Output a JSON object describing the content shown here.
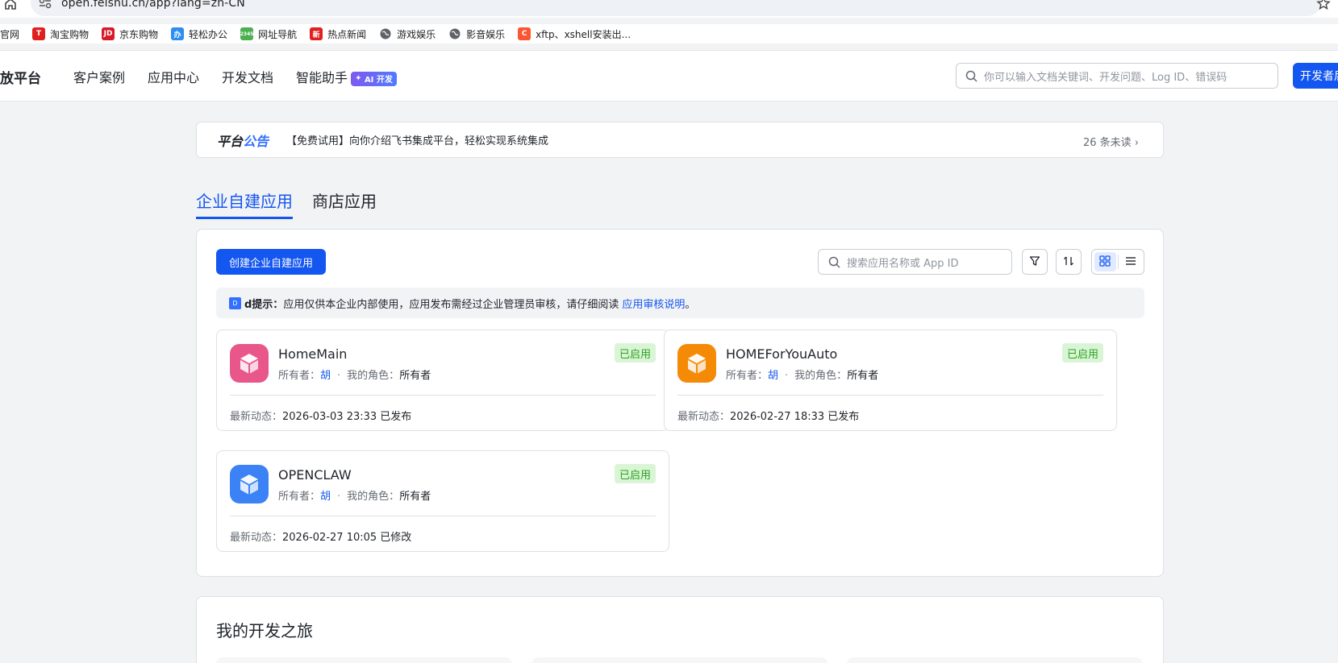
{
  "browser": {
    "url": "open.feishu.cn/app?lang=zh-CN",
    "bookmarks": [
      {
        "label": "官网",
        "icon": "",
        "color": ""
      },
      {
        "label": "淘宝购物",
        "icon": "T",
        "color": "#e0201c"
      },
      {
        "label": "京东购物",
        "icon": "JD",
        "color": "#d8192a"
      },
      {
        "label": "轻松办公",
        "icon": "办",
        "color": "#2b8ef0"
      },
      {
        "label": "网址导航",
        "icon": "2345",
        "color": "#4caf50"
      },
      {
        "label": "热点新闻",
        "icon": "新",
        "color": "#e02020"
      },
      {
        "label": "游戏娱乐",
        "icon": "globe",
        "color": "#5f6368"
      },
      {
        "label": "影音娱乐",
        "icon": "globe",
        "color": "#5f6368"
      },
      {
        "label": "xftp、xshell安装出...",
        "icon": "C",
        "color": "#fc5531"
      }
    ]
  },
  "nav": {
    "brand": "放平台",
    "links": [
      "客户案例",
      "应用中心",
      "开发文档",
      "智能助手"
    ],
    "ai_badge": "AI 开发",
    "search_placeholder": "你可以输入文档关键词、开发问题、Log ID、错误码",
    "dev_button": "开发者后台"
  },
  "announcement": {
    "title_a": "平台",
    "title_b": "公告",
    "text": "【免费试用】向你介绍飞书集成平台，轻松实现系统集成",
    "unread": "26 条未读",
    "chevron": "›"
  },
  "tabs": [
    {
      "label": "企业自建应用",
      "active": true
    },
    {
      "label": "商店应用",
      "active": false
    }
  ],
  "apps_panel": {
    "create_button": "创建企业自建应用",
    "search_placeholder": "搜索应用名称或 App ID",
    "tip_badge": "D",
    "tip_label": "d提示：",
    "tip_text": "应用仅供本企业内部使用，应用发布需经过企业管理员审核，请仔细阅读",
    "tip_link": "应用审核说明",
    "tip_end": "。",
    "owner_label": "所有者：",
    "role_label": "我的角色：",
    "activity_label": "最新动态：",
    "dot": "·",
    "apps": [
      {
        "name": "HomeMain",
        "owner": "胡",
        "role": "所有者",
        "status": "已启用",
        "activity": "2026-03-03 23:33 已发布",
        "color": "#e8568a"
      },
      {
        "name": "HOMEForYouAuto",
        "owner": "胡",
        "role": "所有者",
        "status": "已启用",
        "activity": "2026-02-27 18:33 已发布",
        "color": "#f58a07"
      },
      {
        "name": "OPENCLAW",
        "owner": "胡",
        "role": "所有者",
        "status": "已启用",
        "activity": "2026-02-27 10:05 已修改",
        "color": "#3b82f6"
      }
    ]
  },
  "journey": {
    "title": "我的开发之旅"
  }
}
